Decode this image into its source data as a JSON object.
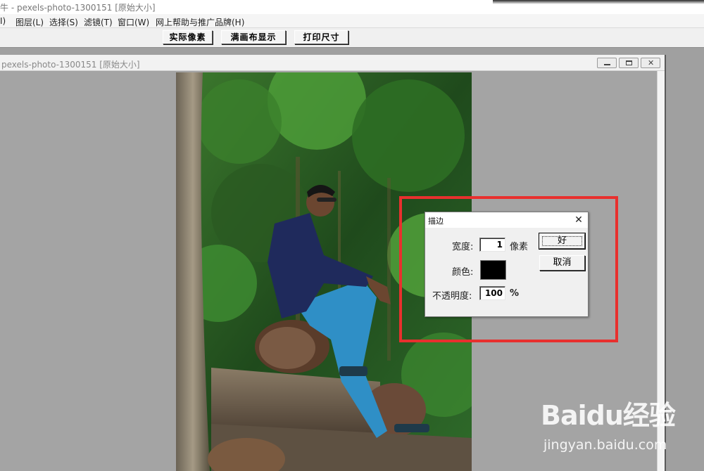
{
  "app": {
    "title": "牛 - pexels-photo-1300151 [原始大小]"
  },
  "menu": {
    "items": [
      {
        "label": "I)"
      },
      {
        "label": "图层(L)"
      },
      {
        "label": "选择(S)"
      },
      {
        "label": "滤镜(T)"
      },
      {
        "label": "窗口(W)"
      },
      {
        "label": "网上帮助与推广品牌(H)"
      }
    ]
  },
  "toolbar": {
    "buttons": [
      {
        "label": "实际像素"
      },
      {
        "label": "满画布显示"
      },
      {
        "label": "打印尺寸"
      }
    ]
  },
  "document": {
    "title": "pexels-photo-1300151 [原始大小]"
  },
  "dialog": {
    "title": "描边",
    "close_glyph": "✕",
    "width_label": "宽度:",
    "width_value": "1",
    "width_unit": "像素",
    "color_label": "颜色:",
    "color_value": "#000000",
    "opacity_label": "不透明度:",
    "opacity_value": "100",
    "opacity_unit": "%",
    "ok_label": "好",
    "cancel_label": "取消"
  },
  "watermark": {
    "logo": "Baidu经验",
    "url": "jingyan.baidu.com"
  },
  "colors": {
    "highlight": "#e8302e",
    "workspace": "#a0a0a0"
  }
}
